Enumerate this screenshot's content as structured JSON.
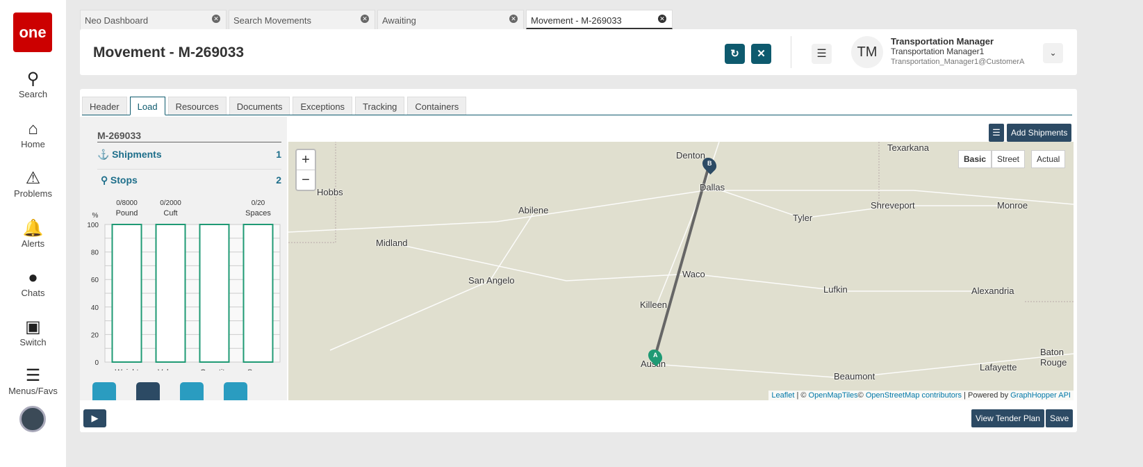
{
  "sidebar": {
    "logo": "one",
    "items": [
      {
        "label": "Search",
        "icon": "search-icon"
      },
      {
        "label": "Home",
        "icon": "home-icon"
      },
      {
        "label": "Problems",
        "icon": "warning-icon"
      },
      {
        "label": "Alerts",
        "icon": "bell-icon"
      },
      {
        "label": "Chats",
        "icon": "chat-icon"
      },
      {
        "label": "Switch",
        "icon": "switch-icon"
      },
      {
        "label": "Menus/Favs",
        "icon": "menu-icon"
      }
    ]
  },
  "tabs": [
    {
      "label": "Neo Dashboard"
    },
    {
      "label": "Search Movements"
    },
    {
      "label": "Awaiting"
    },
    {
      "label": "Movement - M-269033",
      "active": true
    }
  ],
  "header": {
    "title": "Movement - M-269033",
    "user": {
      "initials": "TM",
      "role": "Transportation Manager",
      "name": "Transportation Manager1",
      "email": "Transportation_Manager1@CustomerA"
    }
  },
  "subtabs": [
    "Header",
    "Load",
    "Resources",
    "Documents",
    "Exceptions",
    "Tracking",
    "Containers"
  ],
  "load": {
    "id": "M-269033",
    "shipments_label": "Shipments",
    "shipments_count": "1",
    "stops_label": "Stops",
    "stops_count": "2"
  },
  "chart_data": {
    "type": "bar",
    "ylabel": "%",
    "ylim": [
      0,
      100
    ],
    "yticks": [
      "0",
      "20",
      "40",
      "60",
      "80",
      "100"
    ],
    "categories": [
      "Weight",
      "Volume",
      "Quantity",
      "Space"
    ],
    "capacity_labels": [
      [
        "0/8000",
        "Pound"
      ],
      [
        "0/2000",
        "Cuft"
      ],
      [
        "",
        ""
      ],
      [
        "0/20",
        "Spaces"
      ]
    ],
    "values": [
      0,
      0,
      0,
      0
    ]
  },
  "map": {
    "add_shipments": "Add Shipments",
    "zoom_in": "+",
    "zoom_out": "−",
    "layers": [
      "Basic",
      "Street",
      "Actual"
    ],
    "cities": [
      "Denton",
      "Dallas",
      "Hobbs",
      "Abilene",
      "Shreveport",
      "Monroe",
      "Tyler",
      "Midland",
      "San Angelo",
      "Waco",
      "Lufkin",
      "Alexandria",
      "Killeen",
      "Baton Rouge",
      "Austin",
      "Lafayette",
      "Beaumont",
      "Texarkana"
    ],
    "markers": [
      "A",
      "B"
    ],
    "attribution": {
      "leaflet": "Leaflet",
      "sep1": " | © ",
      "omt": "OpenMapTiles",
      "sep2": "© ",
      "osm": "OpenStreetMap contributors",
      "sep3": " | Powered by ",
      "gh": "GraphHopper API"
    }
  },
  "footer": {
    "view_tender_plan": "View Tender Plan",
    "save": "Save"
  },
  "colors": {
    "accent": "#0e5a6e",
    "bar": "#1f9a74",
    "brand": "#cc0000"
  }
}
